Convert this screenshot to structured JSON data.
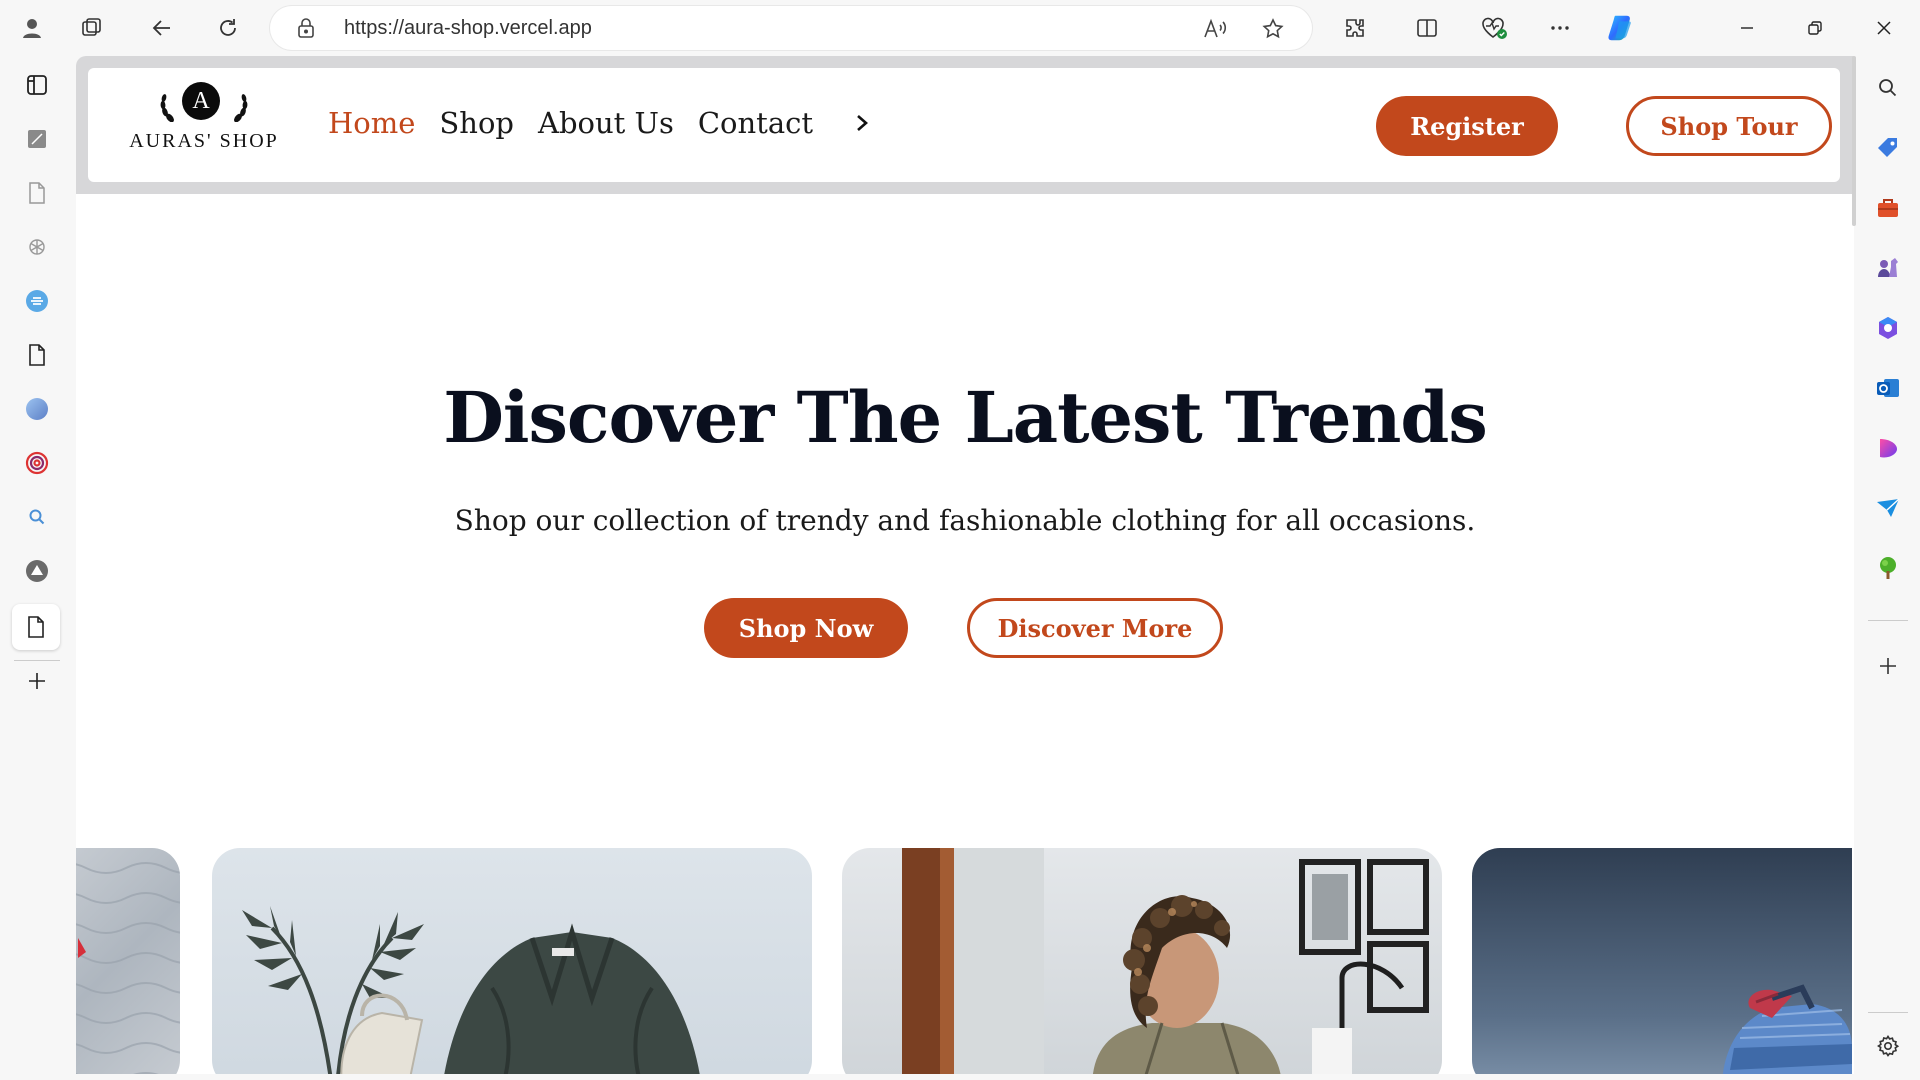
{
  "browser": {
    "url": "https://aura-shop.vercel.app",
    "toolbar_icons": [
      "profile-icon",
      "workspaces-icon",
      "back-icon",
      "refresh-icon",
      "site-info-icon",
      "read-aloud-icon",
      "favorites-star-icon",
      "extensions-icon",
      "split-screen-icon",
      "browser-essentials-icon",
      "more-options-icon",
      "copilot-icon",
      "minimize-icon",
      "restore-icon",
      "close-icon"
    ],
    "left_sidebar_icons": [
      "tab-actions-icon",
      "note-icon",
      "page-icon",
      "openai-icon",
      "link-icon",
      "document-icon",
      "circle-app-icon",
      "swirl-app-icon",
      "search-icon",
      "up-arrow-app-icon",
      "active-page-icon",
      "new-tab-icon"
    ],
    "right_sidebar_icons": [
      "search-icon",
      "shopping-tag-icon",
      "tools-briefcase-icon",
      "games-icon",
      "microsoft365-icon",
      "outlook-icon",
      "designer-icon",
      "send-icon",
      "tree-icon",
      "add-icon",
      "settings-icon"
    ]
  },
  "site": {
    "logo_letter": "A",
    "logo_text": "AURAS' SHOP",
    "nav": [
      {
        "label": "Home",
        "active": true
      },
      {
        "label": "Shop",
        "active": false
      },
      {
        "label": "About Us",
        "active": false
      },
      {
        "label": "Contact",
        "active": false
      }
    ],
    "register_label": "Register",
    "tour_label": "Shop Tour"
  },
  "hero": {
    "title": "Discover The Latest Trends",
    "subtitle": "Shop our collection of trendy and fashionable clothing for all occasions.",
    "primary_cta": "Shop Now",
    "secondary_cta": "Discover More"
  },
  "colors": {
    "accent": "#c2481c",
    "title": "#0a0f1e"
  },
  "gallery": [
    "knit-fabric-image",
    "jacket-and-plant-image",
    "woman-curly-hair-image",
    "blue-sneaker-image"
  ]
}
